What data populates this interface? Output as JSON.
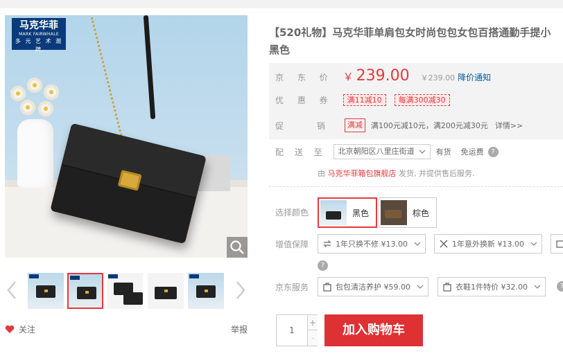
{
  "brand": {
    "name_cn": "马克华菲",
    "name_en": "MARK FAIRWHALE",
    "tagline": "多 元 艺 术 潮 牌"
  },
  "gallery": {
    "thumbnail_count": 6,
    "selected_thumbnail": 2,
    "follow_label": "关注",
    "report_label": "举报"
  },
  "product": {
    "title": "【520礼物】马克华菲单肩包女时尚包包女包百搭通勤手提小",
    "title_line2": "黑色"
  },
  "price": {
    "label": "京 东 价",
    "currency": "￥",
    "value": "239.00",
    "original": "￥239.00",
    "notice_link": "降价通知"
  },
  "coupons": {
    "label": "优 惠 券",
    "items": [
      "满11减10",
      "每满300减30"
    ]
  },
  "promotion": {
    "label": "促 销",
    "tag": "满减",
    "text": "满100元减10元，满200元减30元",
    "more": "详情>>"
  },
  "shipping": {
    "label": "配 送 至",
    "address": "北京朝阳区八里庄街道",
    "stock": "有货",
    "freeship": "免运费",
    "seller_prefix": "由",
    "seller_shop": "马克华菲箱包旗舰店",
    "seller_suffix": "发货, 并提供售后服务."
  },
  "color": {
    "label": "选择颜色",
    "options": [
      {
        "name": "黑色",
        "selected": true
      },
      {
        "name": "棕色",
        "selected": false
      }
    ]
  },
  "value_added": {
    "label": "增值保障",
    "items": [
      "1年只换不修 ¥13.00",
      "1年意外换新 ¥13.00"
    ]
  },
  "jd_service": {
    "label": "京东服务",
    "items": [
      "包包清洁养护 ¥59.00",
      "衣鞋1件特价 ¥32.00"
    ]
  },
  "purchase": {
    "quantity": "1",
    "plus": "+",
    "minus": "-",
    "add_to_cart": "加入购物车"
  },
  "colors": {
    "accent": "#e4393c",
    "link": "#005aa0",
    "brand": "#0a3a7a"
  }
}
